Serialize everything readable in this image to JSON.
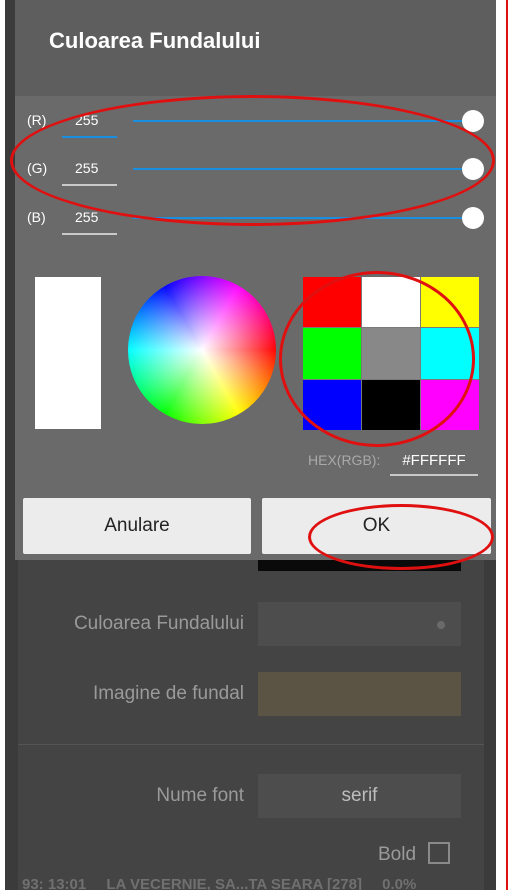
{
  "dialog": {
    "title": "Culoarea Fundalului",
    "rgb": [
      {
        "label": "(R)",
        "value": "255",
        "level": 1.0
      },
      {
        "label": "(G)",
        "value": "255",
        "level": 1.0
      },
      {
        "label": "(B)",
        "value": "255",
        "level": 1.0
      }
    ],
    "preview_color": "#FFFFFF",
    "palette": [
      "#FF0000",
      "#FFFFFF",
      "#FFFF00",
      "#00FF00",
      "#888888",
      "#00FFFF",
      "#0000FF",
      "#000000",
      "#FF00FF"
    ],
    "hex_label": "HEX(RGB):",
    "hex_value": "#FFFFFF",
    "cancel_label": "Anulare",
    "ok_label": "OK"
  },
  "background": {
    "rows": [
      {
        "label": "Culoarea Fundalului"
      },
      {
        "label": "Imagine de fundal"
      },
      {
        "label": "Nume font",
        "value": "serif"
      }
    ],
    "bold_label": "Bold",
    "status": [
      "93: 13:01",
      "LA VECERNIE, SA...TA SEARA [278]",
      "0.0%"
    ]
  },
  "colors": {
    "accent": "#1A8FE0",
    "annotation": "#E01010"
  }
}
